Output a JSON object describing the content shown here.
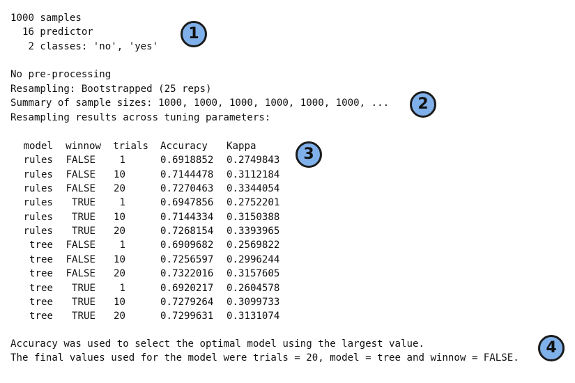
{
  "header": {
    "line1": "1000 samples",
    "line2": "  16 predictor",
    "line3": "   2 classes: 'no', 'yes'"
  },
  "resampling": {
    "line1": "No pre-processing",
    "line2": "Resampling: Bootstrapped (25 reps)",
    "line3": "Summary of sample sizes: 1000, 1000, 1000, 1000, 1000, 1000, ...",
    "line4": "Resampling results across tuning parameters:"
  },
  "results_table": {
    "headers": [
      "model",
      "winnow",
      "trials",
      "Accuracy",
      "Kappa"
    ],
    "rows": [
      [
        "rules",
        "FALSE",
        "1",
        "0.6918852",
        "0.2749843"
      ],
      [
        "rules",
        "FALSE",
        "10",
        "0.7144478",
        "0.3112184"
      ],
      [
        "rules",
        "FALSE",
        "20",
        "0.7270463",
        "0.3344054"
      ],
      [
        "rules",
        "TRUE",
        "1",
        "0.6947856",
        "0.2752201"
      ],
      [
        "rules",
        "TRUE",
        "10",
        "0.7144334",
        "0.3150388"
      ],
      [
        "rules",
        "TRUE",
        "20",
        "0.7268154",
        "0.3393965"
      ],
      [
        "tree",
        "FALSE",
        "1",
        "0.6909682",
        "0.2569822"
      ],
      [
        "tree",
        "FALSE",
        "10",
        "0.7256597",
        "0.2996244"
      ],
      [
        "tree",
        "FALSE",
        "20",
        "0.7322016",
        "0.3157605"
      ],
      [
        "tree",
        "TRUE",
        "1",
        "0.6920217",
        "0.2604578"
      ],
      [
        "tree",
        "TRUE",
        "10",
        "0.7279264",
        "0.3099733"
      ],
      [
        "tree",
        "TRUE",
        "20",
        "0.7299631",
        "0.3131074"
      ]
    ]
  },
  "footer": {
    "line1": "Accuracy was used to select the optimal model using the largest value.",
    "line2": "The final values used for the model were trials = 20, model = tree and winnow = FALSE."
  },
  "badges": {
    "b1": "1",
    "b2": "2",
    "b3": "3",
    "b4": "4",
    "color": "#7fb0e9"
  }
}
